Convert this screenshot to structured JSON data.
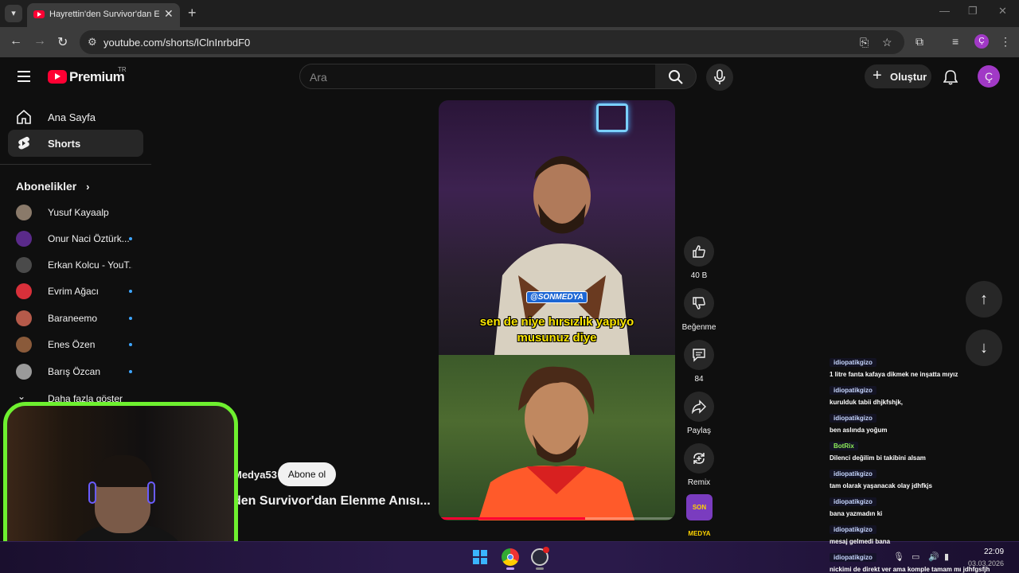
{
  "browser": {
    "tab_title": "Hayrettin'den Survivor'dan Elenme Anısı",
    "url": "youtube.com/shorts/lClnInrbdF0"
  },
  "header": {
    "logo_text": "Premium",
    "country": "TR",
    "search_placeholder": "Ara",
    "create_label": "Oluştur",
    "avatar_letter": "Ç"
  },
  "sidebar": {
    "items": [
      {
        "label": "Ana Sayfa",
        "icon": "home-icon"
      },
      {
        "label": "Shorts",
        "icon": "shorts-icon"
      }
    ],
    "subscriptions_heading": "Abonelikler",
    "subscriptions": [
      {
        "name": "Yusuf Kayaalp",
        "new": false,
        "color": "#8a7a6a"
      },
      {
        "name": "Onur Naci Öztürk...",
        "new": true,
        "color": "#5a2a8a"
      },
      {
        "name": "Erkan Kolcu - YouT...",
        "new": false,
        "color": "#4a4a4a"
      },
      {
        "name": "Evrim Ağacı",
        "new": true,
        "color": "#d8303a"
      },
      {
        "name": "Baraneemo",
        "new": true,
        "color": "#b55a4a"
      },
      {
        "name": "Enes Özen",
        "new": true,
        "color": "#8a5a3a"
      },
      {
        "name": "Barış Özcan",
        "new": true,
        "color": "#9a9a9a"
      }
    ],
    "show_more": "Daha fazla göster"
  },
  "short": {
    "caption_tag": "@SONMEDYA",
    "caption_line1": "sen de niye hırsızlık yapıyo",
    "caption_line2": "musunuz diye",
    "channel_name": "Medya53",
    "subscribe_label": "Abone ol",
    "title": "den Survivor'dan Elenme Anısı...",
    "channel_thumb_text": "SON MEDYA",
    "progress": 0.62
  },
  "actions": {
    "like_count": "40 B",
    "dislike_label": "Beğenme",
    "comment_count": "84",
    "share_label": "Paylaş",
    "remix_label": "Remix"
  },
  "chat": [
    {
      "user": "idiopatikgizo",
      "msg": "1 litre fanta kafaya dikmek ne inşatta mıyız",
      "bot": false
    },
    {
      "user": "idiopatikgizo",
      "msg": "kurulduk tabii dhjkfshjk,",
      "bot": false
    },
    {
      "user": "idiopatikgizo",
      "msg": "ben aslında yoğum",
      "bot": false
    },
    {
      "user": "BotRix",
      "msg": "Dilenci değilim bi takibini alsam",
      "bot": true
    },
    {
      "user": "idiopatikgizo",
      "msg": "tam olarak yaşanacak olay jdhfkjs",
      "bot": false
    },
    {
      "user": "idiopatikgizo",
      "msg": "bana yazmadın ki",
      "bot": false
    },
    {
      "user": "idiopatikgizo",
      "msg": "mesaj gelmedi bana",
      "bot": false
    },
    {
      "user": "idiopatikgizo",
      "msg": "nickimi de direkt ver ama komple tamam mı jdhfgsfjh",
      "bot": false
    }
  ],
  "taskbar": {
    "time": "22:09",
    "date": "03.03.2026"
  }
}
